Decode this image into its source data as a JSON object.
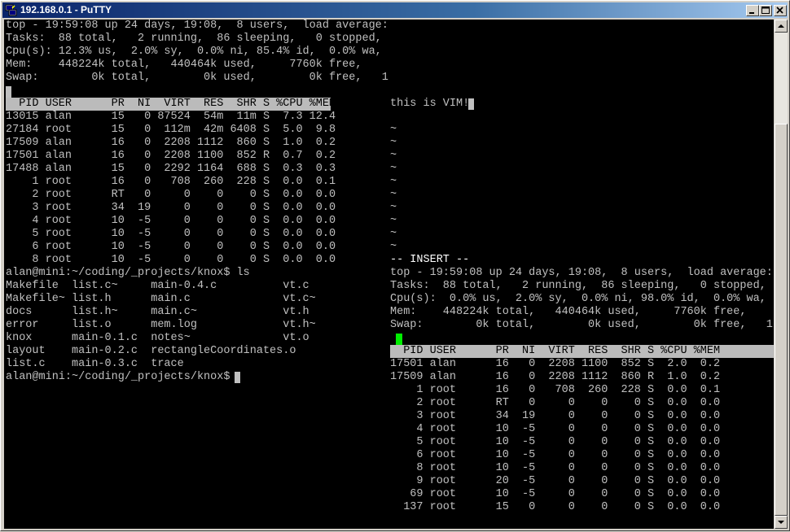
{
  "window": {
    "title": "192.168.0.1 - PuTTY"
  },
  "left": {
    "top_summary": [
      "top - 19:59:08 up 24 days, 19:08,  8 users,  load average:",
      "Tasks:  88 total,   2 running,  86 sleeping,   0 stopped,",
      "Cpu(s): 12.3% us,  2.0% sy,  0.0% ni, 85.4% id,  0.0% wa,",
      "Mem:    448224k total,   440464k used,     7760k free,",
      "Swap:        0k total,        0k used,        0k free,   1"
    ],
    "header": "  PID USER      PR  NI  VIRT  RES  SHR S %CPU %MEM",
    "rows": [
      "13015 alan      15   0 87524  54m  11m S  7.3 12.4",
      "27184 root      15   0  112m  42m 6408 S  5.0  9.8",
      "17509 alan      16   0  2208 1112  860 S  1.0  0.2",
      "17501 alan      16   0  2208 1100  852 R  0.7  0.2",
      "17488 alan      15   0  2292 1164  688 S  0.3  0.3",
      "    1 root      16   0   708  260  228 S  0.0  0.1",
      "    2 root      RT   0     0    0    0 S  0.0  0.0",
      "    3 root      34  19     0    0    0 S  0.0  0.0",
      "    4 root      10  -5     0    0    0 S  0.0  0.0",
      "    5 root      10  -5     0    0    0 S  0.0  0.0",
      "    6 root      10  -5     0    0    0 S  0.0  0.0",
      "    8 root      10  -5     0    0    0 S  0.0  0.0"
    ],
    "prompt_ls": "alan@mini:~/coding/_projects/knox$ ls",
    "ls_rows": [
      "Makefile  list.c~     main-0.4.c          vt.c",
      "Makefile~ list.h      main.c              vt.c~",
      "docs      list.h~     main.c~             vt.h",
      "error     list.o      mem.log             vt.h~",
      "knox      main-0.1.c  notes~              vt.o",
      "layout    main-0.2.c  rectangleCoordinates.o",
      "list.c    main-0.3.c  trace"
    ],
    "prompt": "alan@mini:~/coding/_projects/knox$ "
  },
  "right": {
    "vim_text": "this is VIM!",
    "tilde": "~",
    "insert": "-- INSERT --",
    "top_summary": [
      "top - 19:59:08 up 24 days, 19:08,  8 users,  load average:",
      "Tasks:  88 total,   2 running,  86 sleeping,   0 stopped,",
      "Cpu(s):  0.0% us,  2.0% sy,  0.0% ni, 98.0% id,  0.0% wa,",
      "Mem:    448224k total,   440464k used,     7760k free,",
      "Swap:        0k total,        0k used,        0k free,   1"
    ],
    "header": "  PID USER      PR  NI  VIRT  RES  SHR S %CPU %MEM",
    "rows": [
      "17501 alan      16   0  2208 1100  852 S  2.0  0.2",
      "17509 alan      16   0  2208 1112  860 R  1.0  0.2",
      "    1 root      16   0   708  260  228 S  0.0  0.1",
      "    2 root      RT   0     0    0    0 S  0.0  0.0",
      "    3 root      34  19     0    0    0 S  0.0  0.0",
      "    4 root      10  -5     0    0    0 S  0.0  0.0",
      "    5 root      10  -5     0    0    0 S  0.0  0.0",
      "    6 root      10  -5     0    0    0 S  0.0  0.0",
      "    8 root      10  -5     0    0    0 S  0.0  0.0",
      "    9 root      20  -5     0    0    0 S  0.0  0.0",
      "   69 root      10  -5     0    0    0 S  0.0  0.0",
      "  137 root      15   0     0    0    0 S  0.0  0.0"
    ]
  }
}
